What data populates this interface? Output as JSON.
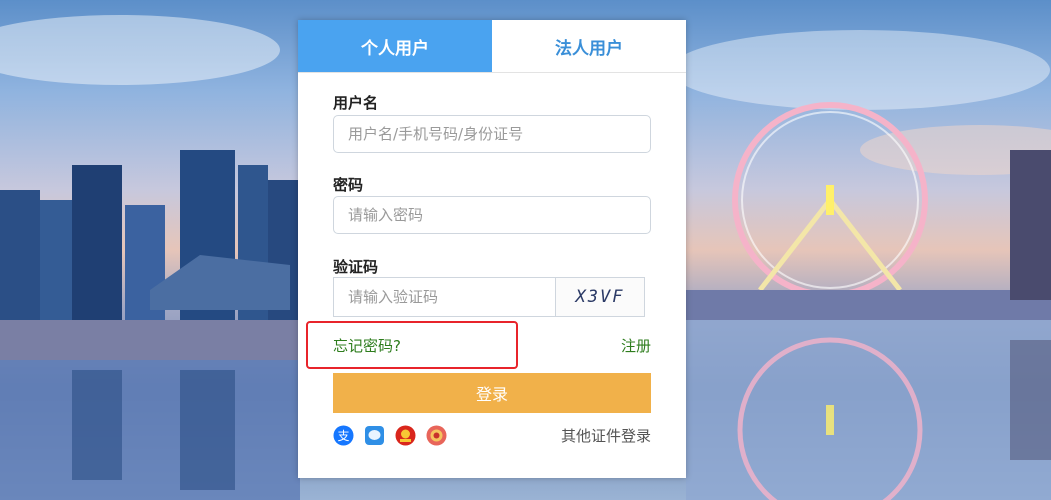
{
  "tabs": {
    "personal": "个人用户",
    "legal": "法人用户"
  },
  "form": {
    "username_label": "用户名",
    "username_placeholder": "用户名/手机号码/身份证号",
    "password_label": "密码",
    "password_placeholder": "请输入密码",
    "captcha_label": "验证码",
    "captcha_placeholder": "请输入验证码",
    "captcha_text": "X3VF"
  },
  "links": {
    "forgot_password": "忘记密码?",
    "register": "注册"
  },
  "login_button": "登录",
  "alt_logins": {
    "icons": [
      "alipay-icon",
      "chat-icon",
      "national-emblem-icon",
      "police-badge-icon"
    ],
    "other_label": "其他证件登录"
  },
  "colors": {
    "tab_active": "#4aa3f0",
    "tab_inactive_text": "#3a8fd8",
    "login_button": "#f1b14a",
    "link_green": "#2e7d1d",
    "highlight_red": "#e8242b"
  }
}
